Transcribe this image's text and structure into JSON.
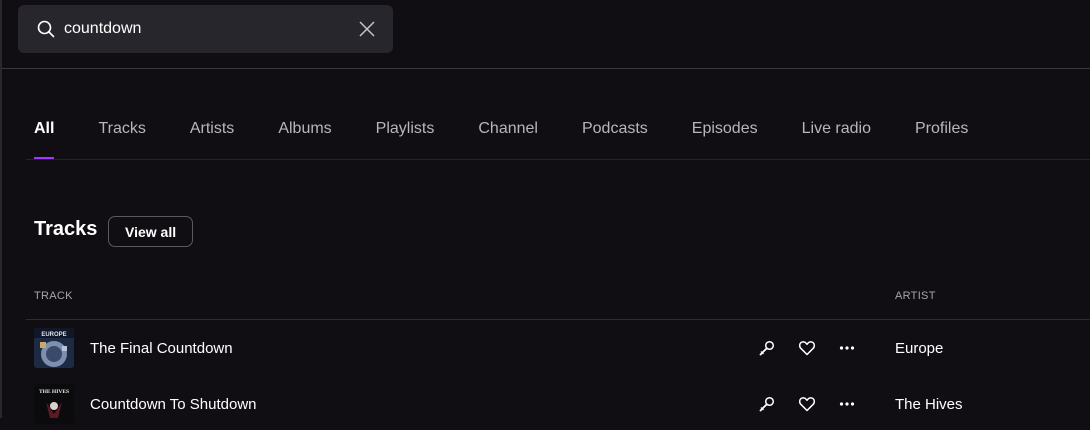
{
  "search": {
    "value": "countdown"
  },
  "tabs": [
    {
      "label": "All"
    },
    {
      "label": "Tracks"
    },
    {
      "label": "Artists"
    },
    {
      "label": "Albums"
    },
    {
      "label": "Playlists"
    },
    {
      "label": "Channel"
    },
    {
      "label": "Podcasts"
    },
    {
      "label": "Episodes"
    },
    {
      "label": "Live radio"
    },
    {
      "label": "Profiles"
    }
  ],
  "active_tab": "All",
  "tracks_section": {
    "title": "Tracks",
    "view_all_label": "View all",
    "columns": {
      "track": "TRACK",
      "artist": "ARTIST"
    },
    "rows": [
      {
        "title": "The Final Countdown",
        "artist": "Europe",
        "cover_text": "EUROPE",
        "actions": [
          "microphone-icon",
          "heart-icon",
          "more-icon"
        ]
      },
      {
        "title": "Countdown To Shutdown",
        "artist": "The Hives",
        "cover_text": "THE HIVES",
        "actions": [
          "microphone-icon",
          "heart-icon",
          "more-icon"
        ]
      }
    ]
  },
  "colors": {
    "accent": "#a238ff",
    "background": "#100e13",
    "search_bg": "#28262d"
  }
}
